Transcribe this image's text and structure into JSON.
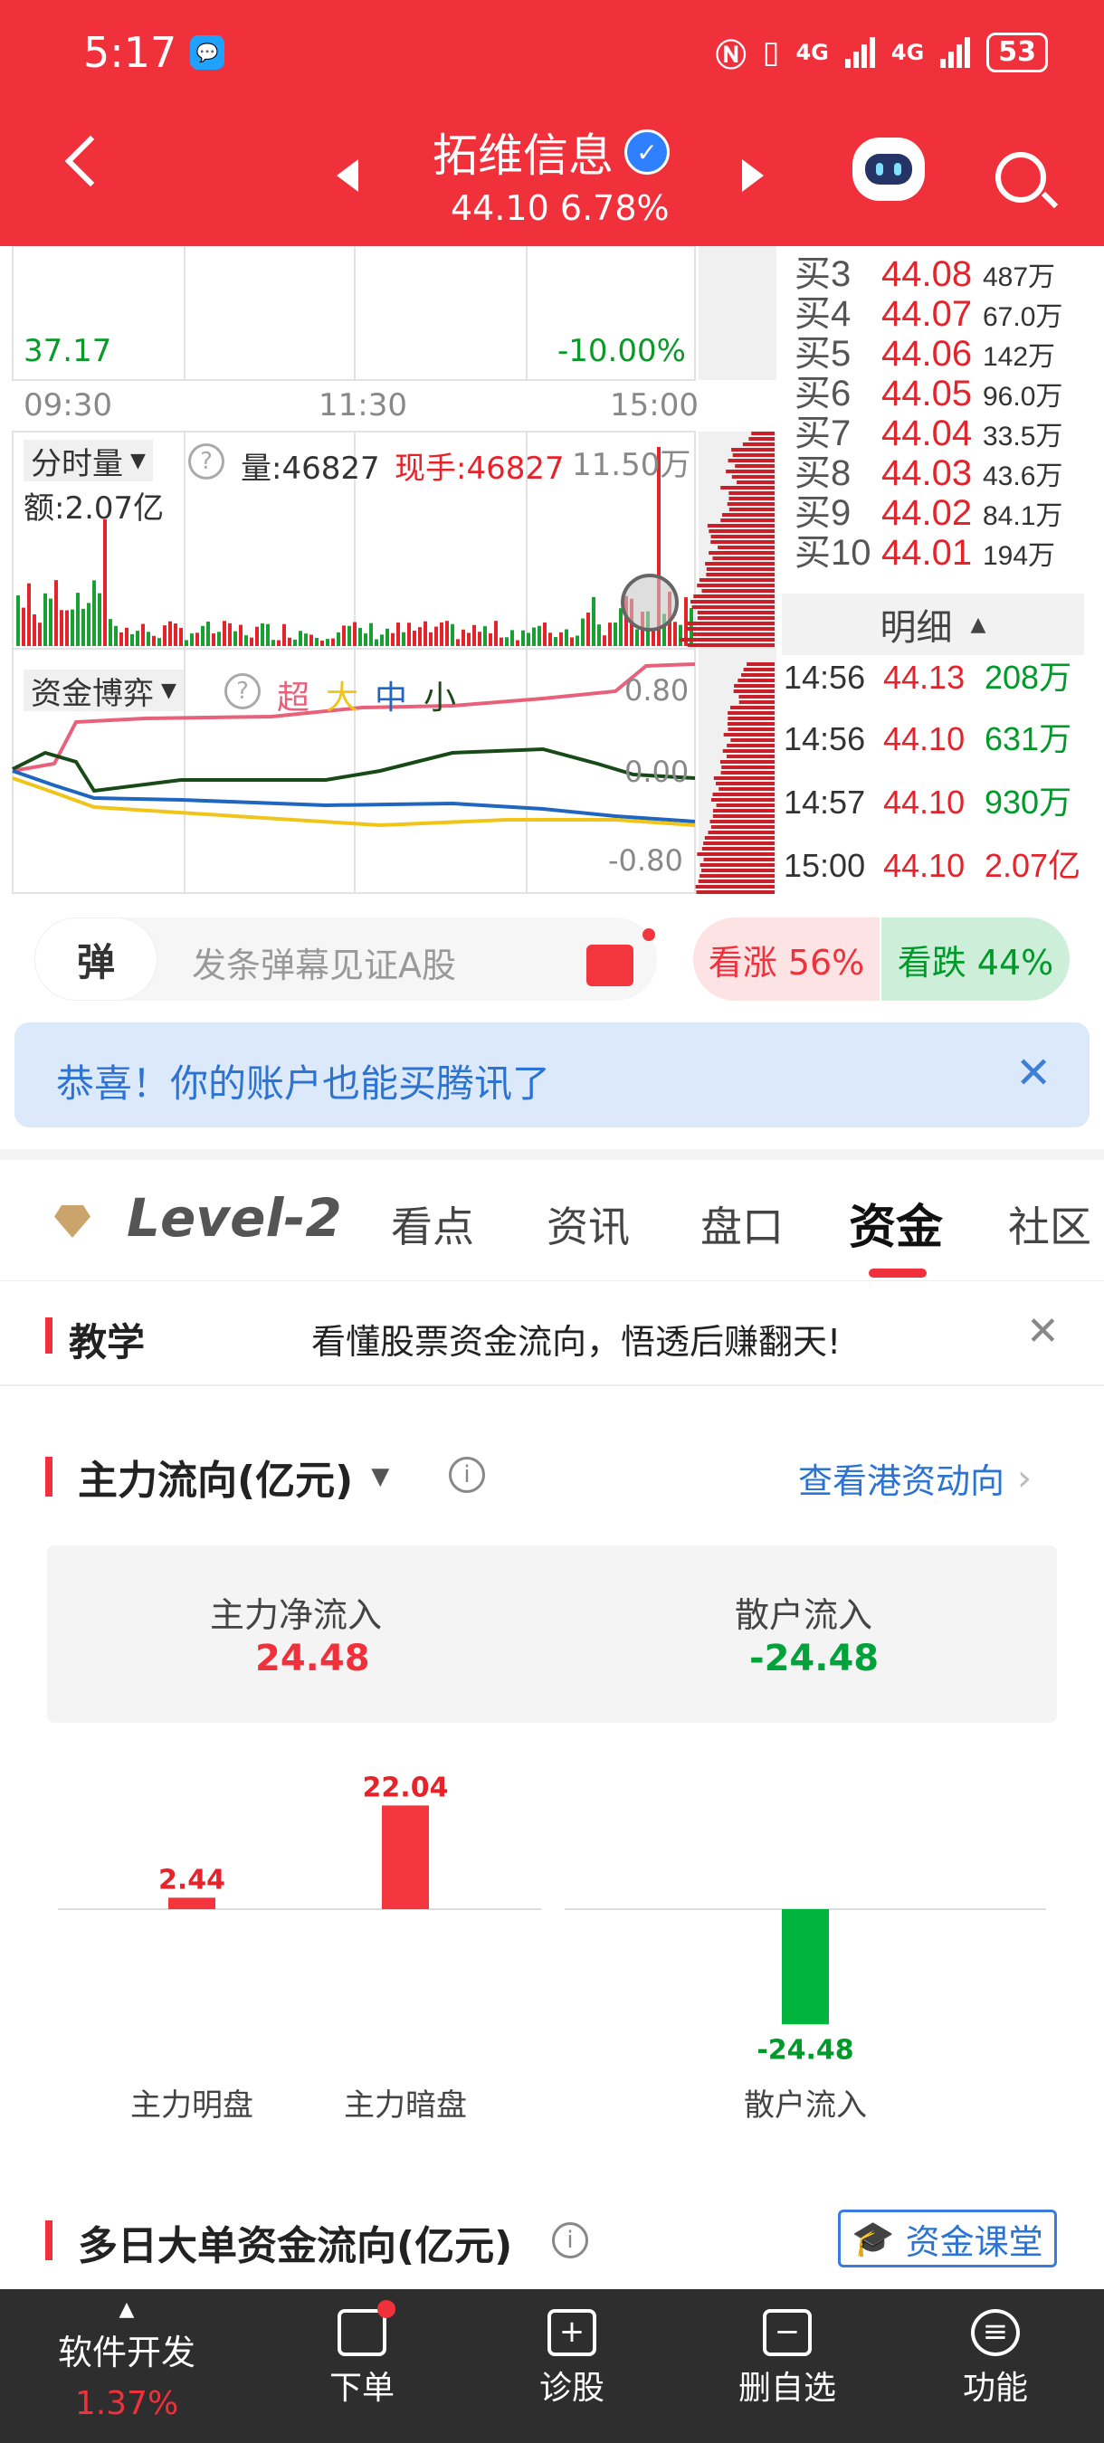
{
  "status_bar": {
    "time": "5:17",
    "battery": "53",
    "network1": "4G",
    "network2": "4G"
  },
  "header": {
    "stock_name": "拓维信息",
    "price": "44.10",
    "change_pct": "6.78%",
    "verified_icon": "v-badge-icon"
  },
  "chart": {
    "low_price": "37.17",
    "low_pct": "-10.00%",
    "times": [
      "09:30",
      "11:30",
      "15:00"
    ],
    "volume_indicator": "分时量",
    "volume_label": "量:46827",
    "current_hand": "现手:46827",
    "volume_max": "11.50万",
    "amount": "额:2.07亿",
    "fund_indicator": "资金博弈",
    "fund_legend": [
      "超",
      "大",
      "中",
      "小"
    ],
    "fund_ticks": [
      "0.80",
      "0.00",
      "-0.80"
    ],
    "fund_colors": {
      "super": "#e8607a",
      "large": "#f0c419",
      "medium": "#1e66c0",
      "small": "#184a18"
    }
  },
  "order_book": [
    {
      "label": "买3",
      "price": "44.08",
      "volume": "487万"
    },
    {
      "label": "买4",
      "price": "44.07",
      "volume": "67.0万"
    },
    {
      "label": "买5",
      "price": "44.06",
      "volume": "142万"
    },
    {
      "label": "买6",
      "price": "44.05",
      "volume": "96.0万"
    },
    {
      "label": "买7",
      "price": "44.04",
      "volume": "33.5万"
    },
    {
      "label": "买8",
      "price": "44.03",
      "volume": "43.6万"
    },
    {
      "label": "买9",
      "price": "44.02",
      "volume": "84.1万"
    },
    {
      "label": "买10",
      "price": "44.01",
      "volume": "194万"
    }
  ],
  "detail": {
    "header": "明细",
    "rows": [
      {
        "time": "14:56",
        "price": "44.13",
        "volume": "208万"
      },
      {
        "time": "14:56",
        "price": "44.10",
        "volume": "631万"
      },
      {
        "time": "14:57",
        "price": "44.10",
        "volume": "930万"
      },
      {
        "time": "15:00",
        "price": "44.10",
        "volume": "2.07亿"
      }
    ]
  },
  "danmu": {
    "icon_label": "弹",
    "placeholder": "发条弹幕见证A股",
    "rise_label": "看涨 56%",
    "fall_label": "看跌 44%"
  },
  "banner": {
    "text": "恭喜！你的账户也能买腾讯了"
  },
  "tabs": {
    "level2": "Level-2",
    "items": [
      "看点",
      "资讯",
      "盘口",
      "资金",
      "社区"
    ],
    "active_index": 3
  },
  "teach": {
    "title": "教学",
    "text": "看懂股票资金流向，悟透后赚翻天!"
  },
  "main_flow": {
    "title": "主力流向(亿元)",
    "hk_link": "查看港资动向",
    "net_inflow_label": "主力净流入",
    "net_inflow_value": "24.48",
    "retail_label": "散户流入",
    "retail_value": "-24.48"
  },
  "chart_data": {
    "type": "bar",
    "categories": [
      "主力明盘",
      "主力暗盘",
      "散户流入"
    ],
    "values": [
      2.44,
      22.04,
      -24.48
    ],
    "labels": [
      "2.44",
      "22.04",
      "-24.48"
    ],
    "colors": {
      "positive": "#f3353d",
      "negative": "#00b43e"
    }
  },
  "multi_day": {
    "title": "多日大单资金流向(亿元)",
    "class_button": "资金课堂"
  },
  "bottom_nav": {
    "stock_name": "软件开发",
    "stock_change": "1.37%",
    "items": [
      "下单",
      "诊股",
      "删自选",
      "功能"
    ]
  }
}
